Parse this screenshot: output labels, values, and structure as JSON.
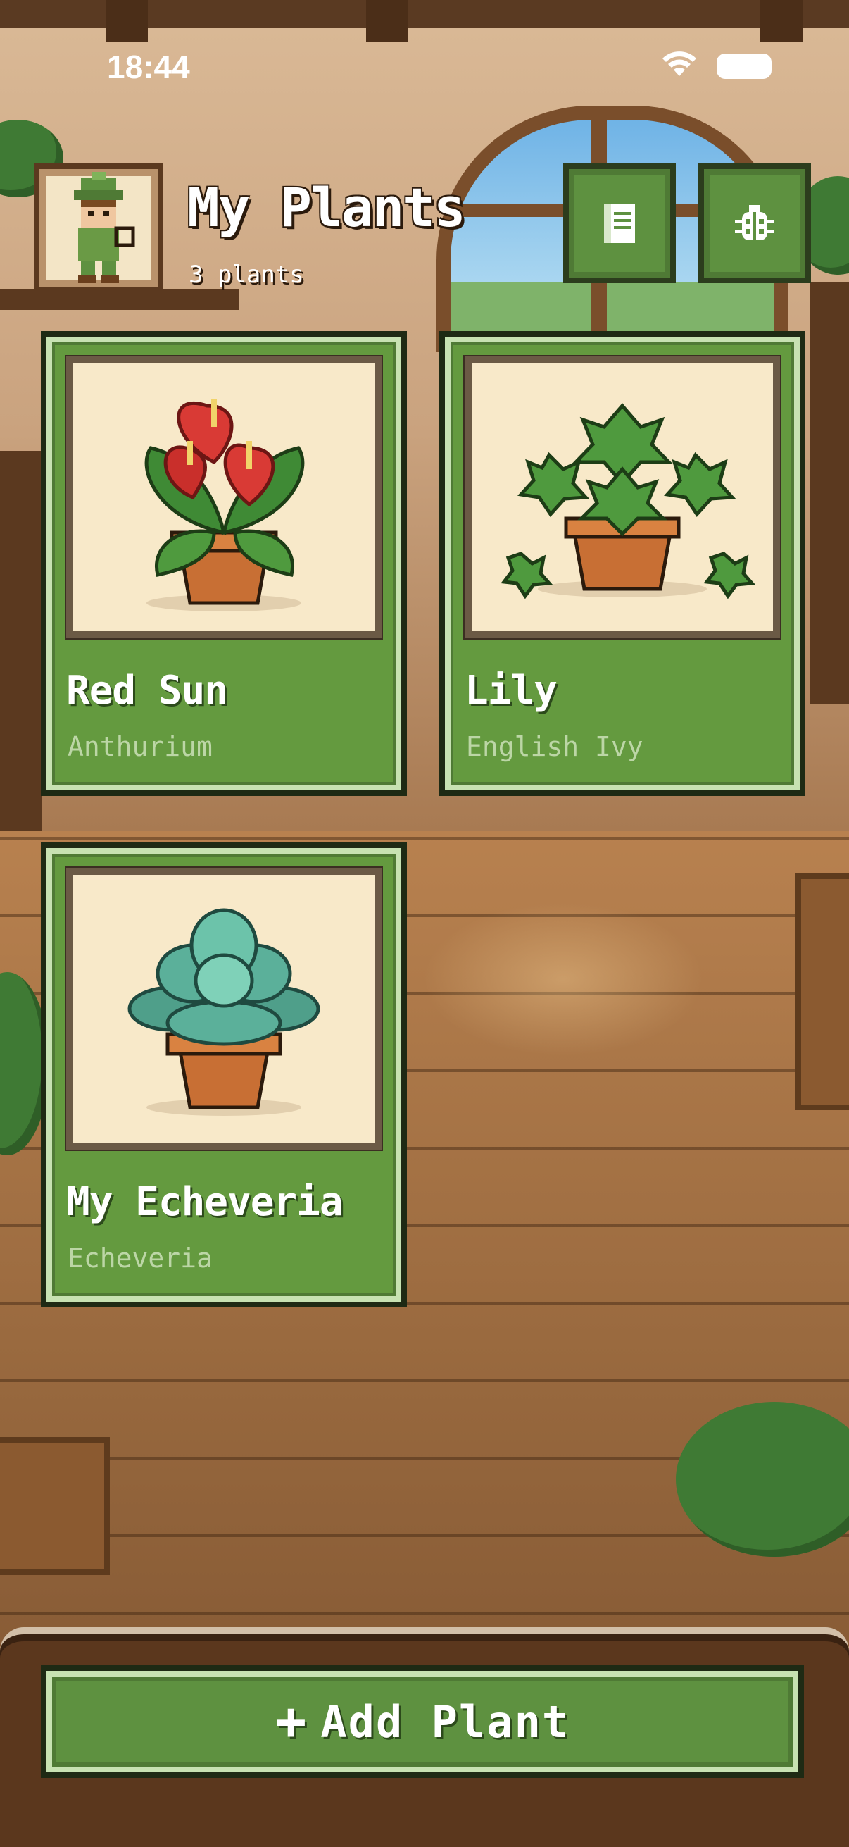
{
  "status_bar": {
    "time": "18:44"
  },
  "header": {
    "title": "My Plants",
    "subtitle": "3 plants"
  },
  "toolbar": {
    "journal_icon": "journal-icon",
    "bug_icon": "ladybug-icon"
  },
  "plants": [
    {
      "name": "Red Sun",
      "species": "Anthurium"
    },
    {
      "name": "Lily",
      "species": "English Ivy"
    },
    {
      "name": "My Echeveria",
      "species": "Echeveria"
    }
  ],
  "actions": {
    "add_plus": "+",
    "add_label": "Add Plant"
  },
  "colors": {
    "card_green": "#649a3f",
    "art_background": "#f8e9c9",
    "floor": "#9a6a3f"
  }
}
